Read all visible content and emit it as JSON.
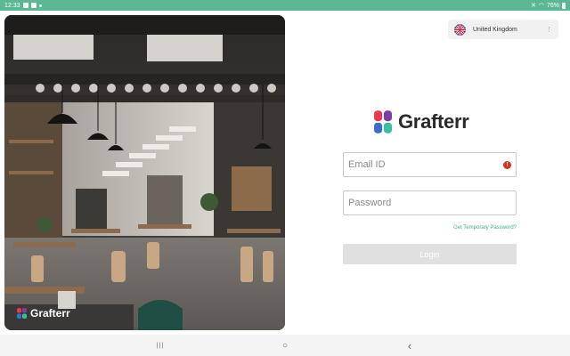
{
  "status_bar": {
    "time": "12:33",
    "battery": "76%",
    "icons": [
      "gallery-icon",
      "image-icon",
      "dot-icon",
      "mute-icon",
      "wifi-icon",
      "battery-icon"
    ]
  },
  "hero": {
    "logo_text": "Grafterr"
  },
  "country_selector": {
    "label": "United Kingdom",
    "flag": "uk-flag-icon",
    "chevron": "⋮"
  },
  "brand": {
    "name": "Grafterr"
  },
  "login_form": {
    "email_placeholder": "Email ID",
    "email_value": "",
    "password_placeholder": "Password",
    "password_value": "",
    "error_indicator": "!",
    "forgot_link": "Get Temporary Password?",
    "login_label": "Login"
  },
  "nav_bar": {
    "recents": "|||",
    "home": "○",
    "back": "‹"
  },
  "colors": {
    "status_bar": "#5cb894",
    "accent": "#3fae8a",
    "error": "#d93025",
    "button_disabled": "#e0e0e0",
    "logo_red": "#e8394e",
    "logo_purple": "#7b3fa0",
    "logo_blue": "#3a6fc9",
    "logo_teal": "#3cbf9e"
  }
}
